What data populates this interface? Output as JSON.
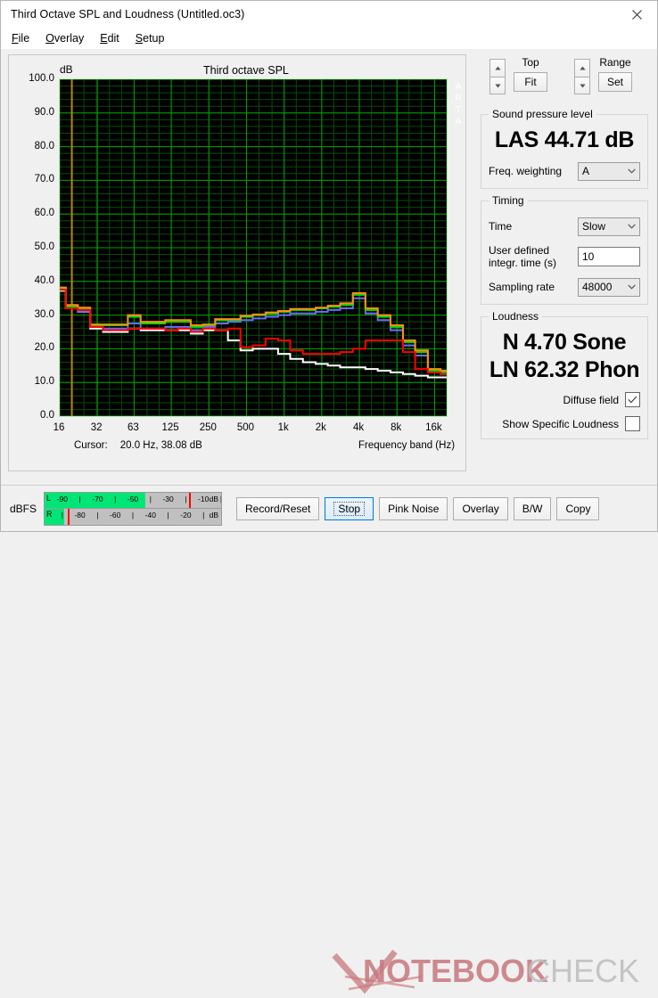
{
  "window": {
    "title": "Third Octave SPL and Loudness (Untitled.oc3)",
    "close_icon": "close-icon"
  },
  "menu": [
    {
      "mnemonic": "F",
      "rest": "ile"
    },
    {
      "mnemonic": "O",
      "rest": "verlay"
    },
    {
      "mnemonic": "E",
      "rest": "dit"
    },
    {
      "mnemonic": "S",
      "rest": "etup"
    }
  ],
  "graph": {
    "title": "Third octave SPL",
    "y_unit": "dB",
    "watermark_vertical": "ARTA",
    "x_axis_title": "Frequency band (Hz)",
    "cursor_label": "Cursor:",
    "cursor_value": "20.0 Hz, 38.08 dB",
    "background": "#000000",
    "grid_color": "#008000",
    "border_color": "#bfe8bf",
    "cursor_line_color": "#b8860b"
  },
  "top_controls": {
    "top_label": "Top",
    "top_button": "Fit",
    "range_label": "Range",
    "range_button": "Set",
    "up_icon": "caret-up-icon",
    "down_icon": "caret-down-icon"
  },
  "spl": {
    "legend": "Sound pressure level",
    "value": "LAS 44.71 dB",
    "weighting_label": "Freq. weighting",
    "weighting_value": "A"
  },
  "timing": {
    "legend": "Timing",
    "time_label": "Time",
    "time_value": "Slow",
    "integr_label_line1": "User defined",
    "integr_label_line2": "integr. time (s)",
    "integr_value": "10",
    "sampling_label": "Sampling rate",
    "sampling_value": "48000"
  },
  "loudness": {
    "legend": "Loudness",
    "sone": "N 4.70 Sone",
    "phon": "LN 62.32 Phon",
    "diffuse_label": "Diffuse field",
    "diffuse_checked": true,
    "specific_label": "Show Specific Loudness",
    "specific_checked": false,
    "check_icon": "checkmark-icon"
  },
  "meter": {
    "label": "dBFS",
    "unit": "dB",
    "left_channel": "L",
    "right_channel": "R",
    "left_fill_pct": 57,
    "right_fill_pct": 11,
    "left_peak_pct": 82,
    "right_peak_pct": 13,
    "top_ticks": [
      "-90",
      "-70",
      "-50",
      "-30",
      "-10"
    ],
    "bottom_ticks": [
      "-80",
      "-60",
      "-40",
      "-20"
    ]
  },
  "buttons": [
    {
      "label": "Record/Reset",
      "focused": false
    },
    {
      "label": "Stop",
      "focused": true
    },
    {
      "label": "Pink Noise",
      "focused": false
    },
    {
      "label": "Overlay",
      "focused": false
    },
    {
      "label": "B/W",
      "focused": false
    },
    {
      "label": "Copy",
      "focused": false
    }
  ],
  "watermark": {
    "text_bold": "NOTEBOOK",
    "text_light": "CHECK",
    "color_bold": "#c8787e",
    "color_light": "#bdbdbd"
  },
  "chart_data": {
    "type": "line",
    "title": "Third octave SPL",
    "xlabel": "Frequency band (Hz)",
    "ylabel": "dB",
    "ylim": [
      0,
      100
    ],
    "ytick_values": [
      0,
      10,
      20,
      30,
      40,
      50,
      60,
      70,
      80,
      90,
      100
    ],
    "ytick_labels": [
      "0.0",
      "10.0",
      "20.0",
      "30.0",
      "40.0",
      "50.0",
      "60.0",
      "70.0",
      "80.0",
      "90.0",
      "100.0"
    ],
    "xtick_labels": [
      "16",
      "32",
      "63",
      "125",
      "250",
      "500",
      "1k",
      "2k",
      "4k",
      "8k",
      "16k"
    ],
    "xtick_values": [
      16,
      32,
      63,
      125,
      250,
      500,
      1000,
      2000,
      4000,
      8000,
      16000
    ],
    "bands": [
      16,
      20,
      25,
      31.5,
      40,
      50,
      63,
      80,
      100,
      125,
      160,
      200,
      250,
      315,
      400,
      500,
      630,
      800,
      1000,
      1250,
      1600,
      2000,
      2500,
      3150,
      4000,
      5000,
      6300,
      8000,
      10000,
      12500,
      16000,
      20000
    ],
    "grid": true,
    "step_style": "hvh",
    "legend_position": "none",
    "series": [
      {
        "name": "green",
        "color": "#00e000",
        "values": [
          38.0,
          32.5,
          32.0,
          27.0,
          27.0,
          27.0,
          29.5,
          27.5,
          27.5,
          28.0,
          28.0,
          26.5,
          27.0,
          28.5,
          28.5,
          29.5,
          30.0,
          30.5,
          31.0,
          31.5,
          31.5,
          32.0,
          32.5,
          33.0,
          36.0,
          31.5,
          29.5,
          26.5,
          22.0,
          19.0,
          13.5,
          13.0
        ]
      },
      {
        "name": "orange",
        "color": "#ff8c1a",
        "values": [
          38.2,
          33.0,
          32.2,
          27.2,
          27.2,
          27.2,
          30.0,
          28.0,
          28.0,
          28.5,
          28.5,
          27.0,
          27.2,
          28.8,
          28.8,
          29.8,
          30.2,
          30.8,
          31.2,
          31.8,
          31.8,
          32.2,
          32.8,
          33.5,
          36.5,
          32.0,
          30.0,
          27.0,
          22.5,
          19.5,
          14.0,
          13.5
        ]
      },
      {
        "name": "blue",
        "color": "#6b6bff",
        "values": [
          37.8,
          32.2,
          31.0,
          26.5,
          26.0,
          26.0,
          27.5,
          26.0,
          26.0,
          26.5,
          26.5,
          25.5,
          26.5,
          27.5,
          28.0,
          28.5,
          29.0,
          29.5,
          30.0,
          30.5,
          30.5,
          31.0,
          31.5,
          32.0,
          35.0,
          30.5,
          28.5,
          25.5,
          21.0,
          18.0,
          13.0,
          12.5
        ]
      },
      {
        "name": "red",
        "color": "#ff0000",
        "values": [
          37.5,
          32.0,
          31.5,
          26.5,
          25.5,
          25.5,
          26.0,
          26.0,
          26.0,
          25.5,
          26.0,
          25.0,
          26.0,
          25.5,
          26.0,
          20.5,
          21.0,
          23.0,
          22.5,
          19.5,
          18.5,
          18.5,
          18.5,
          19.0,
          20.0,
          22.5,
          22.5,
          22.5,
          19.0,
          14.0,
          13.0,
          12.5
        ]
      },
      {
        "name": "white",
        "color": "#ffffff",
        "values": [
          37.2,
          32.0,
          31.0,
          26.0,
          25.0,
          25.0,
          26.0,
          25.5,
          25.5,
          25.5,
          25.5,
          24.5,
          25.5,
          25.5,
          22.5,
          19.5,
          20.0,
          20.0,
          18.5,
          17.0,
          16.0,
          15.5,
          15.0,
          14.5,
          14.5,
          14.0,
          13.5,
          13.0,
          12.5,
          12.0,
          11.5,
          11.5
        ]
      }
    ]
  }
}
